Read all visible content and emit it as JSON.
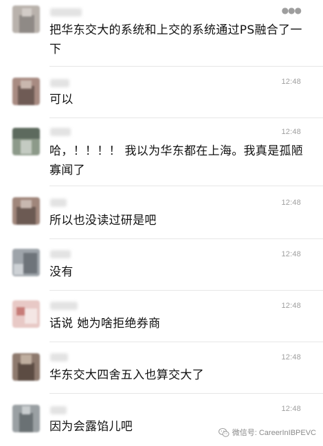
{
  "comments": [
    {
      "id": "c1",
      "text": "把华东交大的系统和上交的系统通过PS融合了一下",
      "time": "",
      "avatar_colors": [
        "#b9b2ac",
        "#8f8a86",
        "#d2ccc7"
      ]
    },
    {
      "id": "c2",
      "text": "可以",
      "time": "12:48",
      "avatar_colors": [
        "#a88b82",
        "#6f5b55",
        "#c9b7ae"
      ]
    },
    {
      "id": "c3",
      "text": "哈，！！！！ 我以为华东都在上海。我真是孤陋寡闻了",
      "time": "12:48",
      "avatar_colors": [
        "#8d9a8a",
        "#5d6a5e",
        "#c4cbc2"
      ]
    },
    {
      "id": "c4",
      "text": "所以也没读过研是吧",
      "time": "12:48",
      "avatar_colors": [
        "#a0867b",
        "#6c5a53",
        "#c8b8b0"
      ]
    },
    {
      "id": "c5",
      "text": "没有",
      "time": "12:48",
      "avatar_colors": [
        "#9ea4aa",
        "#6e747a",
        "#cdd1d5"
      ]
    },
    {
      "id": "c6",
      "text": "话说 她为啥拒绝券商",
      "time": "12:48",
      "avatar_colors": [
        "#e8c9c6",
        "#c77c78",
        "#f4e6e4"
      ]
    },
    {
      "id": "c7",
      "text": "华东交大四舍五入也算交大了",
      "time": "12:48",
      "avatar_colors": [
        "#8e7a6e",
        "#5c4c43",
        "#bfae9f"
      ]
    },
    {
      "id": "c8",
      "text": "因为会露馅儿吧",
      "time": "12:48",
      "avatar_colors": [
        "#9aa0a3",
        "#6a7174",
        "#c9cdcf"
      ]
    }
  ],
  "watermark": {
    "text": "微信号: CareerInIBPEVC",
    "icon": "wechat-logo-icon"
  },
  "more_icon": "more-dots-icon"
}
